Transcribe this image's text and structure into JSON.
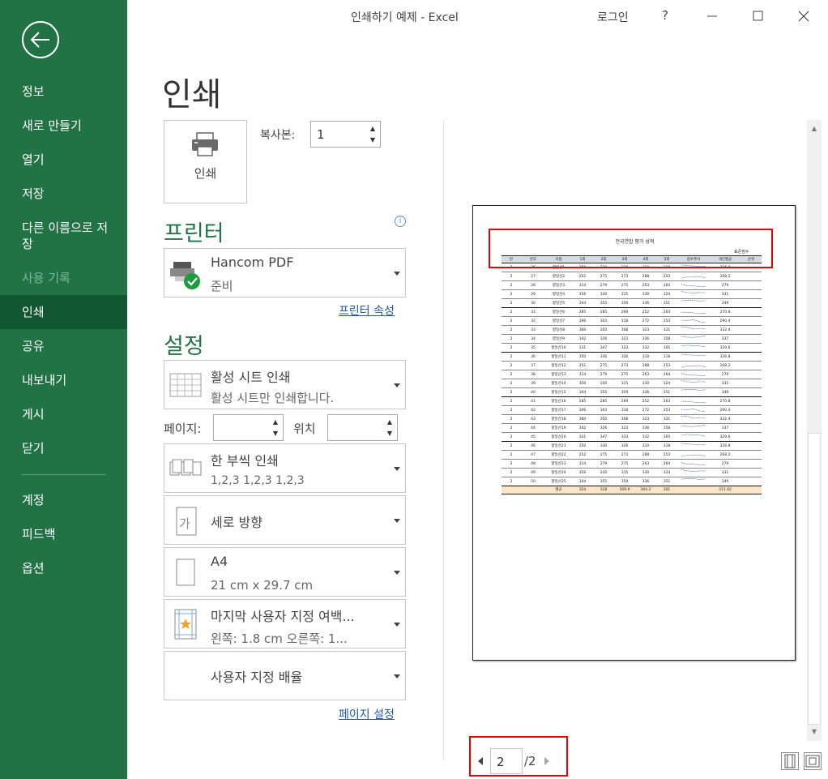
{
  "window": {
    "title": "인쇄하기 예제  -  Excel",
    "login": "로그인",
    "help": "?"
  },
  "sidebar": {
    "items": [
      {
        "label": "정보",
        "state": "normal"
      },
      {
        "label": "새로 만들기",
        "state": "normal"
      },
      {
        "label": "열기",
        "state": "normal"
      },
      {
        "label": "저장",
        "state": "normal"
      },
      {
        "label": "다른 이름으로 저장",
        "state": "normal"
      },
      {
        "label": "사용 기록",
        "state": "disabled"
      },
      {
        "label": "인쇄",
        "state": "active"
      },
      {
        "label": "공유",
        "state": "normal"
      },
      {
        "label": "내보내기",
        "state": "normal"
      },
      {
        "label": "게시",
        "state": "normal"
      },
      {
        "label": "닫기",
        "state": "normal"
      },
      {
        "label": "계정",
        "state": "normal"
      },
      {
        "label": "피드백",
        "state": "normal"
      },
      {
        "label": "옵션",
        "state": "normal"
      }
    ]
  },
  "main": {
    "title": "인쇄",
    "print_button": "인쇄",
    "copies_label": "복사본:",
    "copies_value": "1",
    "printer_heading": "프린터",
    "printer": {
      "name": "Hancom PDF",
      "status": "준비"
    },
    "printer_props_link": "프린터 속성",
    "settings_heading": "설정",
    "settings": {
      "what": {
        "title": "활성 시트 인쇄",
        "sub": "활성 시트만 인쇄합니다."
      },
      "pages_label": "페이지:",
      "position_label": "위치",
      "collate": {
        "title": "한 부씩 인쇄",
        "sub": "1,2,3     1,2,3     1,2,3"
      },
      "orientation": {
        "title": "세로 방향"
      },
      "paper": {
        "title": "A4",
        "sub": "21 cm x 29.7 cm"
      },
      "margins": {
        "title": "마지막 사용자 지정 여백...",
        "sub": "왼쪽:  1.8 cm     오른쪽:  1..."
      },
      "scaling": {
        "title": "사용자 지정 배율"
      }
    },
    "page_setup_link": "페이지 설정"
  },
  "preview": {
    "sheet_title": "전국연합 평가 성적",
    "sheet_std_label": "표준점수",
    "headers": [
      "반",
      "번호",
      "이름",
      "1회",
      "2회",
      "3회",
      "4회",
      "5회",
      "점수추이",
      "개인평균",
      "순위"
    ],
    "rows": [
      [
        "2",
        "26",
        "향일산1",
        "350",
        "330",
        "326",
        "310",
        "318",
        "",
        "326.8",
        ""
      ],
      [
        "2",
        "27",
        "향일산2",
        "252",
        "275",
        "273",
        "288",
        "253",
        "",
        "268.2",
        ""
      ],
      [
        "2",
        "28",
        "향일산3",
        "314",
        "279",
        "275",
        "263",
        "264",
        "",
        "279",
        ""
      ],
      [
        "2",
        "29",
        "향일산4",
        "356",
        "330",
        "315",
        "330",
        "324",
        "",
        "331",
        ""
      ],
      [
        "2",
        "30",
        "향일산5",
        "344",
        "355",
        "359",
        "336",
        "351",
        "",
        "349",
        ""
      ],
      [
        "2",
        "31",
        "향일산6",
        "285",
        "285",
        "269",
        "252",
        "263",
        "",
        "270.8",
        ""
      ],
      [
        "2",
        "32",
        "향일산7",
        "306",
        "303",
        "318",
        "272",
        "253",
        "",
        "290.4",
        ""
      ],
      [
        "2",
        "33",
        "향일산8",
        "360",
        "350",
        "308",
        "323",
        "321",
        "",
        "332.4",
        ""
      ],
      [
        "2",
        "34",
        "향일산9",
        "342",
        "326",
        "323",
        "336",
        "358",
        "",
        "337",
        ""
      ],
      [
        "2",
        "35",
        "향일산10",
        "331",
        "347",
        "333",
        "332",
        "305",
        "",
        "329.6",
        ""
      ],
      [
        "2",
        "36",
        "향일산11",
        "350",
        "330",
        "326",
        "310",
        "318",
        "",
        "326.8",
        ""
      ],
      [
        "2",
        "37",
        "향일산12",
        "252",
        "275",
        "273",
        "288",
        "253",
        "",
        "268.2",
        ""
      ],
      [
        "2",
        "38",
        "향일산13",
        "314",
        "279",
        "275",
        "263",
        "264",
        "",
        "279",
        ""
      ],
      [
        "2",
        "39",
        "향일산14",
        "356",
        "330",
        "315",
        "330",
        "324",
        "",
        "331",
        ""
      ],
      [
        "2",
        "40",
        "향일산15",
        "344",
        "355",
        "359",
        "336",
        "351",
        "",
        "349",
        ""
      ],
      [
        "2",
        "41",
        "향일산16",
        "285",
        "285",
        "269",
        "252",
        "263",
        "",
        "270.8",
        ""
      ],
      [
        "2",
        "42",
        "향일산17",
        "306",
        "303",
        "318",
        "272",
        "253",
        "",
        "290.4",
        ""
      ],
      [
        "2",
        "43",
        "향일산18",
        "360",
        "350",
        "308",
        "323",
        "321",
        "",
        "332.4",
        ""
      ],
      [
        "2",
        "44",
        "향일산19",
        "342",
        "326",
        "323",
        "336",
        "358",
        "",
        "337",
        ""
      ],
      [
        "2",
        "45",
        "향일산20",
        "331",
        "347",
        "333",
        "332",
        "305",
        "",
        "329.6",
        ""
      ],
      [
        "2",
        "46",
        "향일산21",
        "350",
        "330",
        "326",
        "310",
        "318",
        "",
        "326.8",
        ""
      ],
      [
        "2",
        "47",
        "향일산22",
        "252",
        "275",
        "273",
        "288",
        "253",
        "",
        "268.2",
        ""
      ],
      [
        "2",
        "48",
        "향일산23",
        "314",
        "279",
        "275",
        "263",
        "264",
        "",
        "279",
        ""
      ],
      [
        "2",
        "49",
        "향일산24",
        "356",
        "330",
        "315",
        "330",
        "324",
        "",
        "331",
        ""
      ],
      [
        "2",
        "50",
        "향일산25",
        "344",
        "355",
        "359",
        "336",
        "351",
        "",
        "349",
        ""
      ]
    ],
    "avg_row": [
      "",
      "",
      "평균",
      "324",
      "318",
      "309.9",
      "304.2",
      "301",
      "",
      "311.42",
      ""
    ],
    "current_page": "2",
    "total_pages": "/2"
  }
}
